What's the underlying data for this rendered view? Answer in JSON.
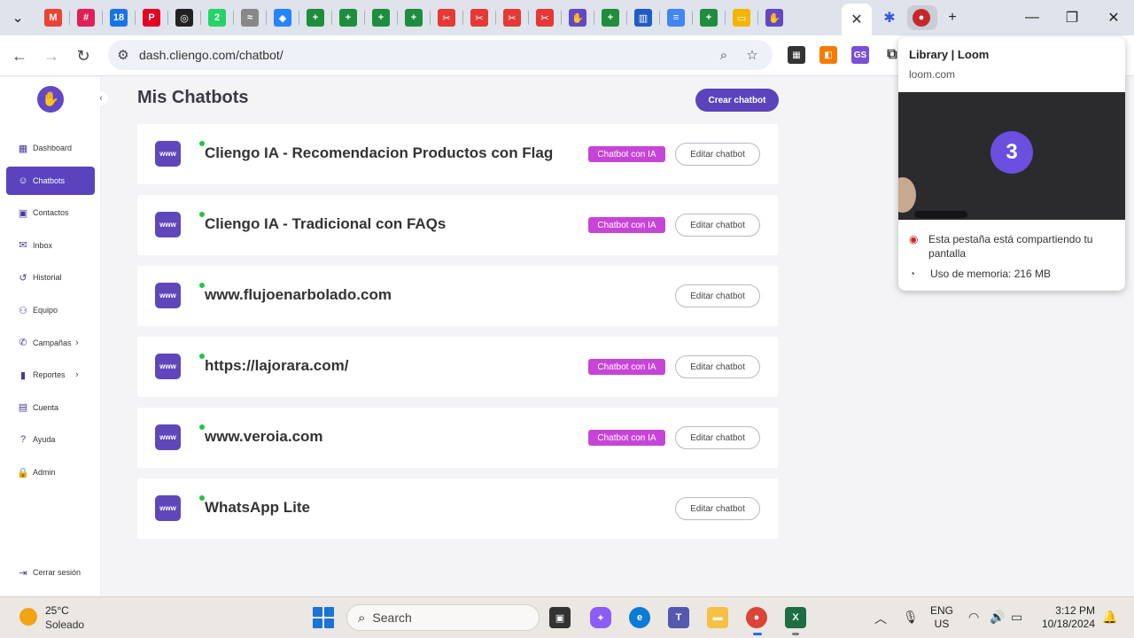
{
  "browser": {
    "tabs": [
      {
        "icon": "chevron-down-icon",
        "glyph": "⌄"
      },
      {
        "icon": "gmail-icon",
        "glyph": "M",
        "color": "#ea4335"
      },
      {
        "icon": "slack-icon",
        "glyph": "#",
        "color": "#e01e5a"
      },
      {
        "icon": "calendar-icon",
        "glyph": "18",
        "color": "#1a73e8"
      },
      {
        "icon": "pinterest-icon",
        "glyph": "P",
        "color": "#e60023"
      },
      {
        "icon": "chatgpt-icon",
        "glyph": "◎",
        "color": "#222222"
      },
      {
        "icon": "whatsapp-icon",
        "glyph": "2",
        "color": "#25d366"
      },
      {
        "icon": "rss-icon",
        "glyph": "≈",
        "color": "#888888"
      },
      {
        "icon": "jira-icon",
        "glyph": "◆",
        "color": "#2684ff"
      },
      {
        "icon": "sheets-icon",
        "glyph": "+",
        "color": "#1e8e3e"
      },
      {
        "icon": "sheets-icon",
        "glyph": "+",
        "color": "#1e8e3e"
      },
      {
        "icon": "sheets-icon",
        "glyph": "+",
        "color": "#1e8e3e"
      },
      {
        "icon": "sheets-icon",
        "glyph": "+",
        "color": "#1e8e3e"
      },
      {
        "icon": "scissors-icon",
        "glyph": "✂",
        "color": "#e53935"
      },
      {
        "icon": "scissors-icon",
        "glyph": "✂",
        "color": "#e53935"
      },
      {
        "icon": "scissors-icon",
        "glyph": "✂",
        "color": "#e53935"
      },
      {
        "icon": "scissors-icon",
        "glyph": "✂",
        "color": "#e53935"
      },
      {
        "icon": "cliengo-icon",
        "glyph": "✋",
        "color": "#6248c6"
      },
      {
        "icon": "sheets-icon",
        "glyph": "+",
        "color": "#1e8e3e"
      },
      {
        "icon": "intercom-icon",
        "glyph": "▥",
        "color": "#1f5cc4"
      },
      {
        "icon": "docs-icon",
        "glyph": "≡",
        "color": "#4285f4"
      },
      {
        "icon": "sheets-icon",
        "glyph": "+",
        "color": "#1e8e3e"
      },
      {
        "icon": "slides-icon",
        "glyph": "▭",
        "color": "#f4b400"
      },
      {
        "icon": "cliengo-icon",
        "glyph": "✋",
        "color": "#6248c6"
      }
    ],
    "active_tab_close": "✕",
    "new_tab": "+",
    "window_controls": {
      "minimize": "—",
      "restore": "❐",
      "close": "✕"
    },
    "url": "dash.cliengo.com/chatbot/"
  },
  "sidebar": {
    "collapse": "‹",
    "items": [
      {
        "label": "Dashboard",
        "icon": "dashboard-icon",
        "glyph": "▦"
      },
      {
        "label": "Chatbots",
        "icon": "chatbot-icon",
        "glyph": "☺",
        "active": true
      },
      {
        "label": "Contactos",
        "icon": "contacts-icon",
        "glyph": "▣"
      },
      {
        "label": "Inbox",
        "icon": "inbox-icon",
        "glyph": "✉"
      },
      {
        "label": "Historial",
        "icon": "history-icon",
        "glyph": "↺"
      },
      {
        "label": "Equipo",
        "icon": "team-icon",
        "glyph": "⚇"
      },
      {
        "label": "Campañas",
        "icon": "megaphone-icon",
        "glyph": "✆",
        "chevron": true
      },
      {
        "label": "Reportes",
        "icon": "bar-chart-icon",
        "glyph": "▮",
        "chevron": true
      },
      {
        "label": "Cuenta",
        "icon": "account-icon",
        "glyph": "▤"
      },
      {
        "label": "Ayuda",
        "icon": "help-icon",
        "glyph": "?"
      },
      {
        "label": "Admin",
        "icon": "lock-icon",
        "glyph": "🔒"
      }
    ],
    "logout": {
      "label": "Cerrar sesión",
      "icon": "logout-icon",
      "glyph": "⇥"
    }
  },
  "main": {
    "title": "Mis Chatbots",
    "create_label": "Crear chatbot",
    "badge_label": "Chatbot con IA",
    "edit_label": "Editar chatbot",
    "bots": [
      {
        "name": "Cliengo IA - Recomendacion Productos con Flag",
        "ai": true
      },
      {
        "name": "Cliengo IA - Tradicional con FAQs",
        "ai": true
      },
      {
        "name": "www.flujoenarbolado.com",
        "ai": false
      },
      {
        "name": "https://lajorara.com/",
        "ai": true
      },
      {
        "name": "www.veroia.com",
        "ai": true
      },
      {
        "name": "WhatsApp Lite",
        "ai": false
      }
    ]
  },
  "hover_card": {
    "title": "Library | Loom",
    "domain": "loom.com",
    "preview_number": "3",
    "sharing_text": "Esta pestaña está compartiendo tu pantalla",
    "memory_text": "Uso de memoria: 216 MB"
  },
  "taskbar": {
    "temperature": "25°C",
    "weather": "Soleado",
    "search_placeholder": "Search",
    "language_1": "ENG",
    "language_2": "US",
    "time": "3:12 PM",
    "date": "10/18/2024"
  }
}
